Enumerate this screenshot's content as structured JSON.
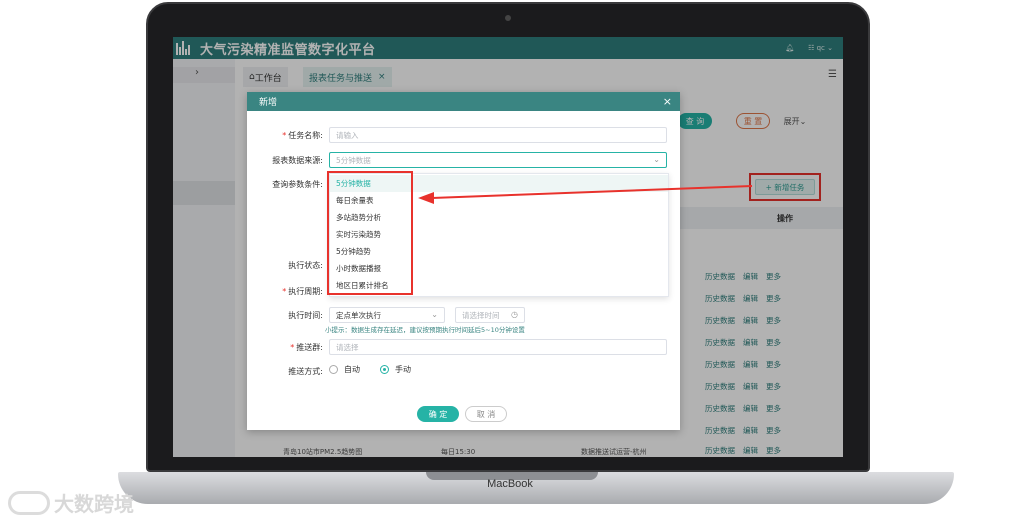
{
  "app": {
    "title": "大气污染精准监管数字化平台",
    "user": "qc",
    "brand": "MacBook"
  },
  "tabs": [
    {
      "label": "工作台"
    },
    {
      "label": "报表任务与推送"
    }
  ],
  "toolbar": {
    "query": "查 询",
    "reset": "重 置",
    "expand": "展开"
  },
  "add_task": "+ 新增任务",
  "table": {
    "ops_header": "操作",
    "row_ops": [
      "历史数据",
      "编辑",
      "更多"
    ],
    "bg_bottom_left": "青岛10站市PM2.5趋势图",
    "bg_bottom_mid": "每日15:30",
    "bg_bottom_right": "数据推送试运营-杭州"
  },
  "dialog": {
    "title": "新增",
    "task_name_label": "任务名称:",
    "task_name_placeholder": "请输入",
    "source_label": "报表数据来源:",
    "source_value": "5分钟数据",
    "params_label": "查询参数条件:",
    "exec_status_label": "执行状态:",
    "exec_cycle_label": "执行周期:",
    "exec_time_label": "执行时间:",
    "exec_time_value": "定点单次执行",
    "time_placeholder": "请选择时间",
    "hint": "小提示：数据生成存在延迟，建议按预期执行时间延后5~10分钟设置",
    "push_group_label": "推送群:",
    "push_group_placeholder": "请选择",
    "push_mode_label": "推送方式:",
    "push_mode_auto": "自动",
    "push_mode_manual": "手动",
    "confirm": "确 定",
    "cancel": "取 消"
  },
  "dropdown": {
    "items": [
      "5分钟数据",
      "每日余量表",
      "多站趋势分析",
      "实时污染趋势",
      "5分钟趋势",
      "小时数据播报",
      "地区日累计排名"
    ]
  },
  "watermark": "大数跨境",
  "colors": {
    "header": "#2f7f7d",
    "accent": "#26b3a6",
    "highlight": "#e8322c"
  }
}
